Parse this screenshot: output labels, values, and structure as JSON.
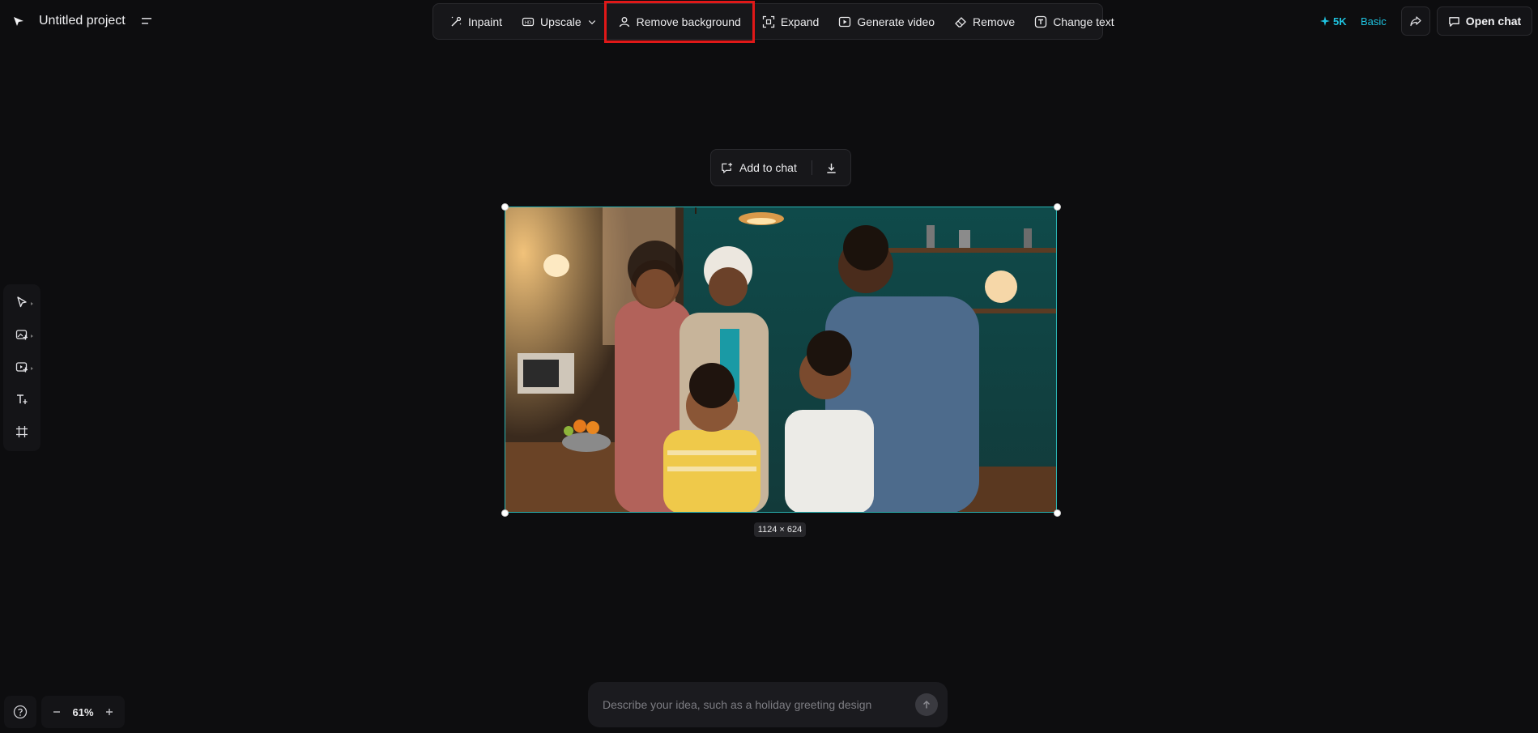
{
  "header": {
    "project_title": "Untitled project"
  },
  "toolbar": {
    "items": [
      {
        "label": "Inpaint",
        "icon": "magic-wand-icon"
      },
      {
        "label": "Upscale",
        "icon": "hd-icon",
        "dropdown": true
      },
      {
        "label": "Remove background",
        "icon": "person-cutout-icon",
        "highlighted": true
      },
      {
        "label": "Expand",
        "icon": "expand-icon"
      },
      {
        "label": "Generate video",
        "icon": "play-icon"
      },
      {
        "label": "Remove",
        "icon": "eraser-icon"
      },
      {
        "label": "Change text",
        "icon": "text-box-icon"
      }
    ],
    "highlight_color": "#e01818"
  },
  "account": {
    "credits": "5K",
    "plan": "Basic",
    "open_chat_label": "Open chat",
    "accent_color": "#1fc3e0"
  },
  "image_actions": {
    "add_to_chat_label": "Add to chat"
  },
  "canvas": {
    "image_size_label": "1124 × 624",
    "selection_color": "#2ab3b3"
  },
  "left_tools": [
    {
      "icon": "pointer-icon",
      "has_submenu": true
    },
    {
      "icon": "image-add-icon",
      "has_submenu": true
    },
    {
      "icon": "video-add-icon",
      "has_submenu": true
    },
    {
      "icon": "text-tool-icon",
      "has_submenu": false
    },
    {
      "icon": "crop-frame-icon",
      "has_submenu": false
    }
  ],
  "zoom": {
    "level": "61%"
  },
  "prompt": {
    "placeholder": "Describe your idea, such as a holiday greeting design"
  }
}
